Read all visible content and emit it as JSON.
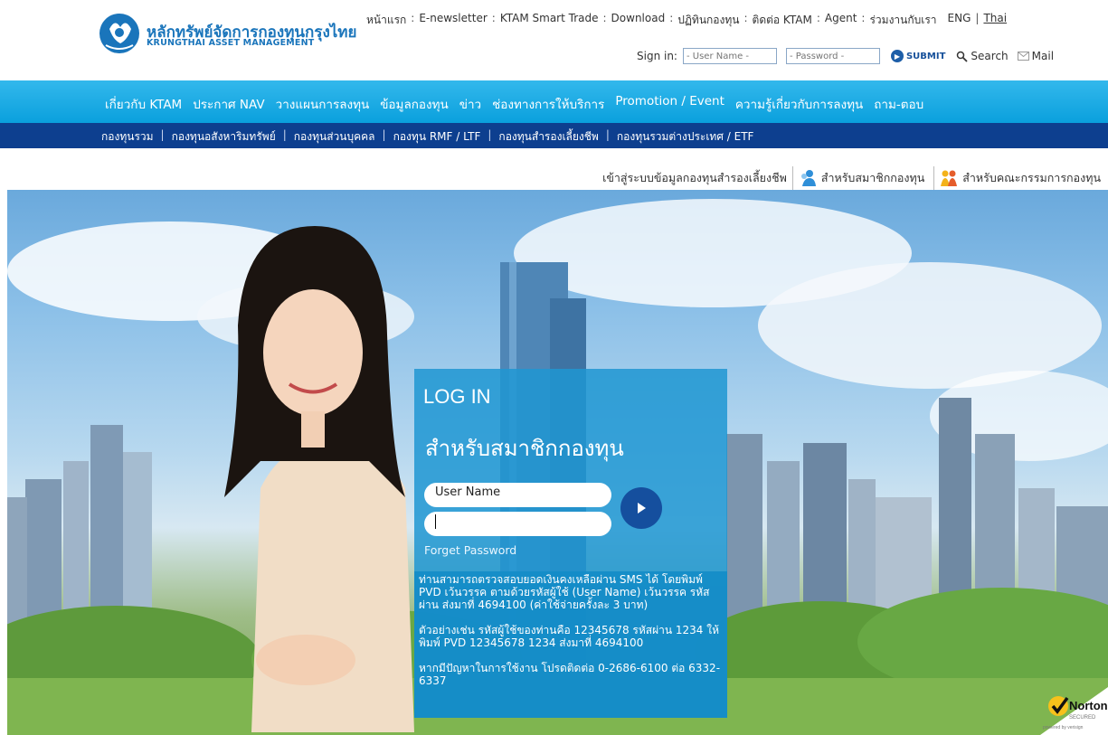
{
  "logo": {
    "thai": "หลักทรัพย์จัดการกองทุนกรุงไทย",
    "english": "KRUNGTHAI ASSET MANAGEMENT"
  },
  "top_links": [
    "หน้าแรก",
    "E-newsletter",
    "KTAM Smart Trade",
    "Download",
    "ปฏิทินกองทุน",
    "ติดต่อ KTAM",
    "Agent",
    "ร่วมงานกับเรา"
  ],
  "separator": ":",
  "lang": {
    "eng": "ENG",
    "divider": "|",
    "thai": "Thai"
  },
  "signin": {
    "label": "Sign in:",
    "user_placeholder": "- User Name -",
    "pass_placeholder": "- Password -",
    "submit": "SUBMIT",
    "search": "Search",
    "mail": "Mail"
  },
  "nav_main": [
    "เกี่ยวกับ KTAM",
    "ประกาศ NAV",
    "วางแผนการลงทุน",
    "ข้อมูลกองทุน",
    "ข่าว",
    "ช่องทางการให้บริการ",
    "Promotion / Event",
    "ความรู้เกี่ยวกับการลงทุน",
    "ถาม-ตอบ"
  ],
  "nav_sub": [
    "กองทุนรวม",
    "กองทุนอสังหาริมทรัพย์",
    "กองทุนส่วนบุคคล",
    "กองทุน RMF / LTF",
    "กองทุนสำรองเลี้ยงชีพ",
    "กองทุนรวมต่างประเทศ / ETF"
  ],
  "nav_sub_divider": "|",
  "pvd_bar": {
    "label": "เข้าสู่ระบบข้อมูลกองทุนสำรองเลี้ยงชีพ",
    "member": "สำหรับสมาชิกกองทุน",
    "committee": "สำหรับคณะกรรมการกองทุน"
  },
  "login": {
    "title": "LOG IN",
    "subtitle": "สำหรับสมาชิกกองทุน",
    "username_label": "User Name",
    "forget": "Forget Password",
    "info1": "ท่านสามารถตรวจสอบยอดเงินคงเหลือผ่าน SMS ได้ โดยพิมพ์ PVD เว้นวรรค ตามด้วยรหัสผู้ใช้ (User Name) เว้นวรรค รหัสผ่าน ส่งมาที่ 4694100 (ค่าใช้จ่ายครั้งละ 3 บาท)",
    "info2": "ตัวอย่างเช่น รหัสผู้ใช้ของท่านคือ 12345678 รหัสผ่าน 1234 ให้พิมพ์ PVD 12345678 1234 ส่งมาที่ 4694100",
    "info3": "หากมีปัญหาในการใช้งาน โปรดติดต่อ 0-2686-6100 ต่อ 6332-6337"
  },
  "norton": {
    "name": "Norton",
    "line2": "SECURED",
    "line3": "powered by verisign"
  },
  "colors": {
    "nav_main": "#12a8e3",
    "nav_sub": "#0d3f8f",
    "brand": "#1a75bb",
    "login_panel": "#1e96d2"
  }
}
